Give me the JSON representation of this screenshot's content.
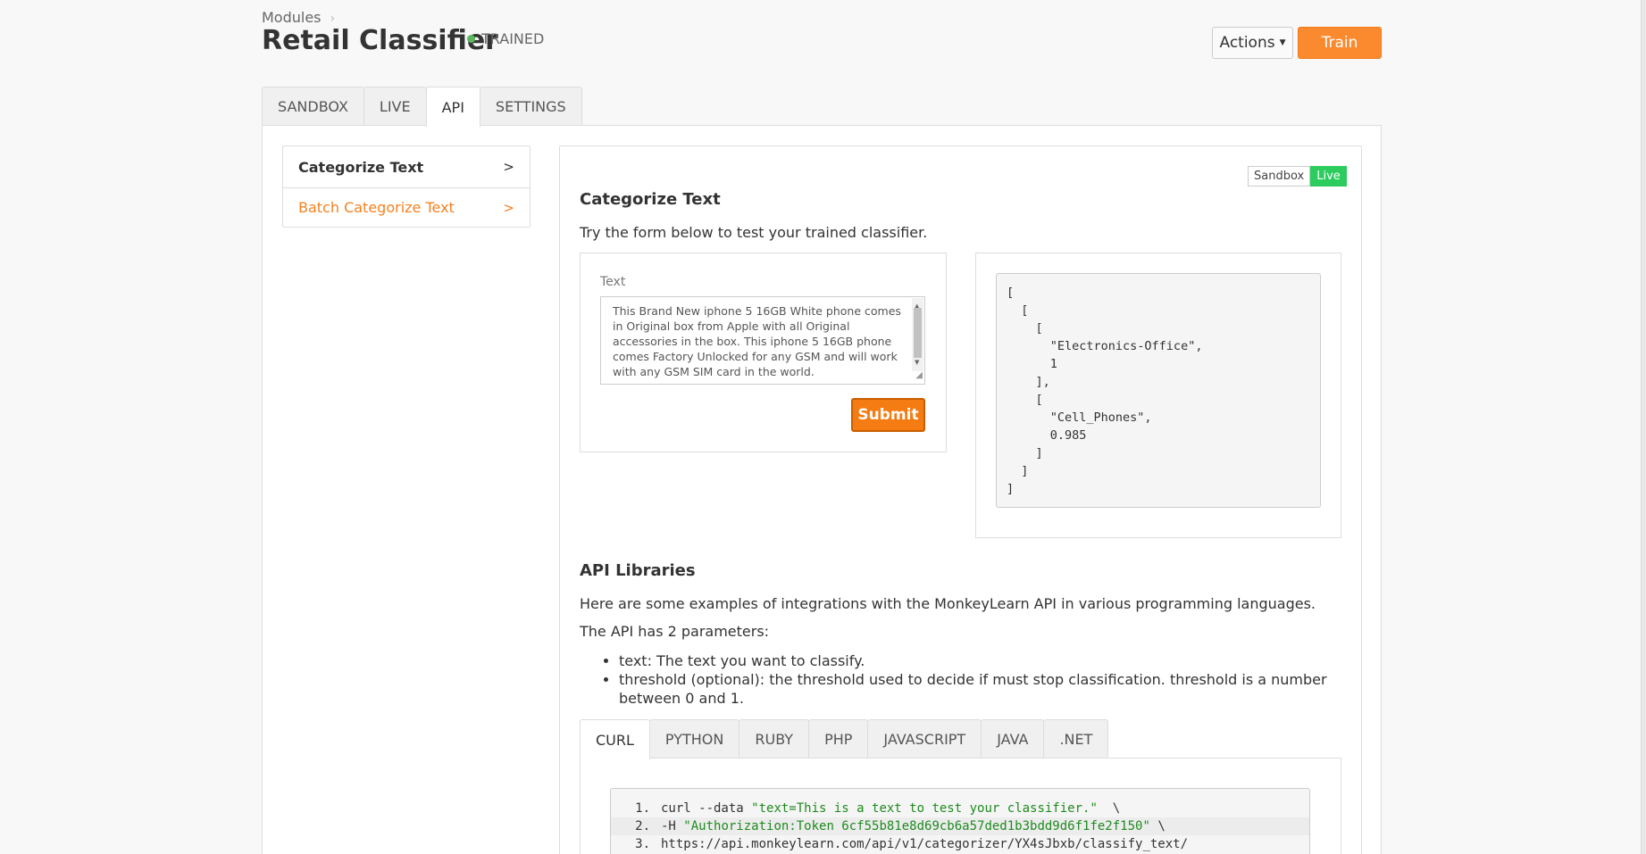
{
  "header": {
    "breadcrumb": "Modules",
    "breadcrumb_sep": "›",
    "title": "Retail Classifier",
    "status": "TRAINED",
    "actions_label": "Actions",
    "train_label": "Train"
  },
  "tabs": [
    {
      "label": "SANDBOX"
    },
    {
      "label": "LIVE"
    },
    {
      "label": "API"
    },
    {
      "label": "SETTINGS"
    }
  ],
  "sidebar": {
    "items": [
      {
        "label": "Categorize Text",
        "chevron": ">"
      },
      {
        "label": "Batch Categorize Text",
        "chevron": ">"
      }
    ]
  },
  "env_toggle": {
    "sandbox": "Sandbox",
    "live": "Live"
  },
  "categorize": {
    "heading": "Categorize Text",
    "description": "Try the form below to test your trained classifier.",
    "text_label": "Text",
    "text_value": "This Brand New iphone 5 16GB White phone comes in Original box from Apple with all Original accessories in the box. This iphone 5 16GB phone comes Factory Unlocked for any GSM and will work with any GSM SIM card in the world.",
    "submit_label": "Submit",
    "result": "[\n  [\n    [\n      \"Electronics-Office\",\n      1\n    ],\n    [\n      \"Cell_Phones\",\n      0.985\n    ]\n  ]\n]"
  },
  "libraries": {
    "heading": "API Libraries",
    "intro": "Here are some examples of integrations with the MonkeyLearn API in various programming languages.",
    "params_intro": "The API has 2 parameters:",
    "params": [
      "text: The text you want to classify.",
      "threshold (optional): the threshold used to decide if must stop classification. threshold is a number between 0 and 1."
    ],
    "lang_tabs": [
      "CURL",
      "PYTHON",
      "RUBY",
      "PHP",
      "JAVASCRIPT",
      "JAVA",
      ".NET"
    ],
    "code": {
      "line1_num": "1.",
      "line1_cmd": "curl --data ",
      "line1_str": "\"text=This is a text to test your classifier.\"",
      "line1_end": "  \\",
      "line2_num": "2.",
      "line2_cmd": "-H ",
      "line2_str": "\"Authorization:Token 6cf55b81e8d69cb6a57ded1b3bdd9d6f1fe2f150\"",
      "line2_end": " \\",
      "line3_num": "3.",
      "line3_cmd": "https://api.monkeylearn.com/api/v1/categorizer/YX4sJbxb/classify_text/"
    }
  }
}
